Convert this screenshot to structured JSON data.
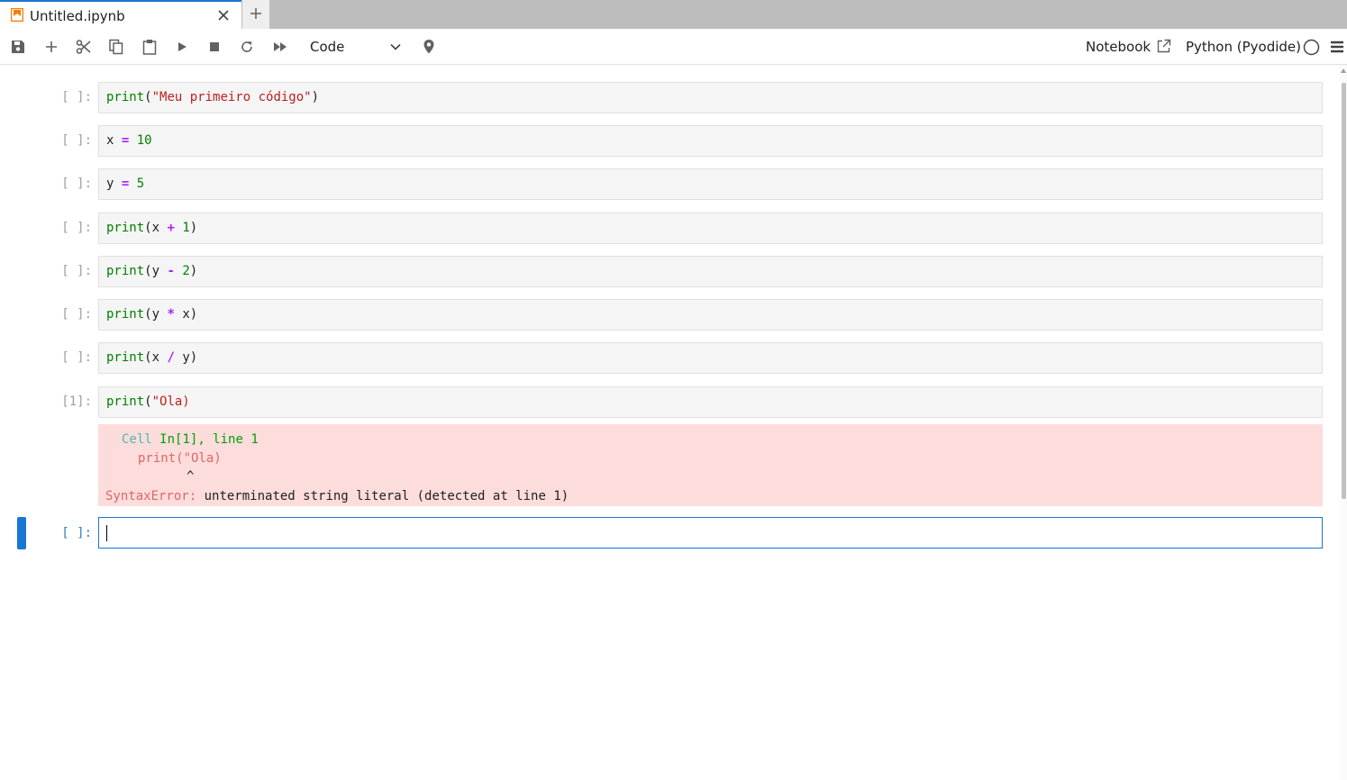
{
  "tab": {
    "title": "Untitled.ipynb",
    "close_symbol": "✕",
    "new_tab_symbol": "+"
  },
  "toolbar": {
    "icons": [
      "save-icon",
      "add-cell-icon",
      "cut-icon",
      "copy-icon",
      "paste-icon",
      "run-icon",
      "stop-icon",
      "restart-icon",
      "run-all-icon"
    ],
    "cell_type": "Code",
    "notebook_label": "Notebook",
    "kernel_label": "Python (Pyodide)"
  },
  "cells": [
    {
      "prompt": "[ ]:",
      "code": "print(\"Meu primeiro código\")"
    },
    {
      "prompt": "[ ]:",
      "code": "x = 10"
    },
    {
      "prompt": "[ ]:",
      "code": "y = 5"
    },
    {
      "prompt": "[ ]:",
      "code": "print(x + 1)"
    },
    {
      "prompt": "[ ]:",
      "code": "print(y - 2)"
    },
    {
      "prompt": "[ ]:",
      "code": "print(y * x)"
    },
    {
      "prompt": "[ ]:",
      "code": "print(x / y)"
    },
    {
      "prompt": "[1]:",
      "code": "print(\"Ola)"
    },
    {
      "prompt": "[ ]:",
      "code": ""
    }
  ],
  "error_output": {
    "location_prefix": "Cell ",
    "location_cell": "In[1]",
    "location_suffix": ", line 1",
    "source_line": "print(\"Ola)",
    "caret": "^",
    "error_type": "SyntaxError:",
    "error_message": "unterminated string literal (detected at line 1)"
  },
  "colors": {
    "accent": "#1976d2",
    "error_background": "#fddcdc"
  }
}
